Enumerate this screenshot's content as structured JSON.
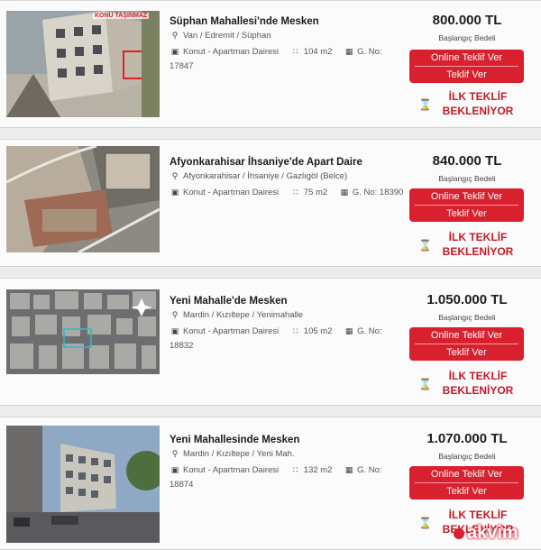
{
  "listings": [
    {
      "title": "Süphan Mahallesi'nde Mesken",
      "location": "Van / Edremit / Süphan",
      "category": "Konut - Apartman Dairesi",
      "area": "104 m2",
      "gno_label": "G. No:",
      "gno_value": "17847",
      "price": "800.000 TL",
      "price_label": "Başlangıç Bedeli",
      "btn_line1": "Online Teklif Ver",
      "btn_line2": "Teklif Ver",
      "await_line1": "İLK TEKLİF",
      "await_line2": "BEKLENİYOR",
      "photo_caption": "KONU TAŞINMAZ"
    },
    {
      "title": "Afyonkarahisar İhsaniye'de Apart Daire",
      "location": "Afyonkarahisar / İhsaniye / Gazlıgöl (Belce)",
      "category": "Konut - Apartman Dairesi",
      "area": "75 m2",
      "gno_label": "G. No:",
      "gno_value": "18390",
      "price": "840.000 TL",
      "price_label": "Başlangıç Bedeli",
      "btn_line1": "Online Teklif Ver",
      "btn_line2": "Teklif Ver",
      "await_line1": "İLK TEKLİF",
      "await_line2": "BEKLENİYOR"
    },
    {
      "title": "Yeni Mahalle'de Mesken",
      "location": "Mardin / Kızıltepe / Yenimahalle",
      "category": "Konut - Apartman Dairesi",
      "area": "105 m2",
      "gno_label": "G. No:",
      "gno_value": "18832",
      "price": "1.050.000 TL",
      "price_label": "Başlangıç Bedeli",
      "btn_line1": "Online Teklif Ver",
      "btn_line2": "Teklif Ver",
      "await_line1": "İLK TEKLİF",
      "await_line2": "BEKLENİYOR"
    },
    {
      "title": "Yeni Mahallesinde Mesken",
      "location": "Mardin / Kızıltepe / Yeni Mah.",
      "category": "Konut - Apartman Dairesi",
      "area": "132 m2",
      "gno_label": "G. No:",
      "gno_value": "18874",
      "price": "1.070.000 TL",
      "price_label": "Başlangıç Bedeli",
      "btn_line1": "Online Teklif Ver",
      "btn_line2": "Teklif Ver",
      "await_line1": "İLK TEKLİF",
      "await_line2": "BEKLENİYOR"
    }
  ],
  "icons": {
    "location": "map-pin-icon",
    "category": "building-icon",
    "area": "area-icon",
    "gno": "grid-icon",
    "await": "hourglass-icon"
  },
  "colors": {
    "accent": "#d8202e",
    "await_text": "#c21b28"
  },
  "watermark": "akvim"
}
